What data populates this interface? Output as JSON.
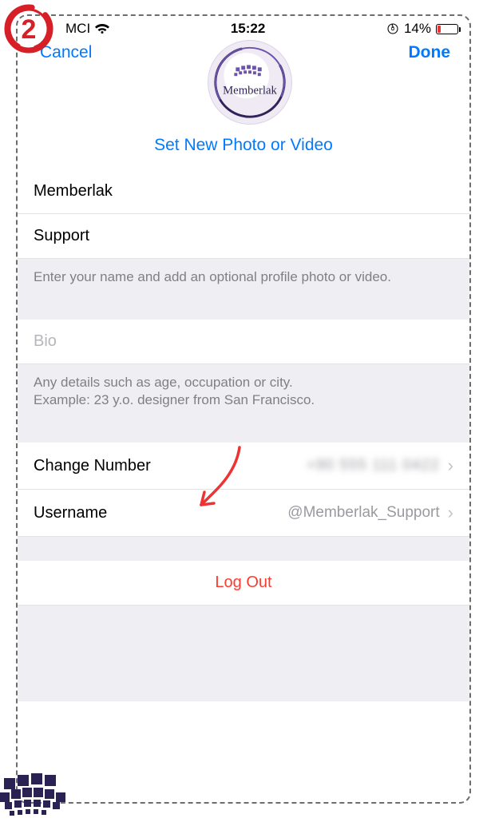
{
  "statusbar": {
    "carrier": "MCI",
    "time": "15:22",
    "battery_pct": "14%"
  },
  "header": {
    "cancel": "Cancel",
    "done": "Done"
  },
  "avatar": {
    "brand_text": "Memberlak"
  },
  "set_photo_label": "Set New Photo or Video",
  "name": {
    "first": "Memberlak",
    "last": "Support",
    "hint": "Enter your name and add an optional profile photo or video."
  },
  "bio": {
    "placeholder": "Bio",
    "hint_line1": "Any details such as age, occupation or city.",
    "hint_line2": "Example: 23 y.o. designer from San Francisco."
  },
  "rows": {
    "change_number": {
      "label": "Change Number",
      "value_blurred": "+90 555 111 0422"
    },
    "username": {
      "label": "Username",
      "value": "@Memberlak_Support"
    }
  },
  "logout_label": "Log Out",
  "step_badge": "2"
}
